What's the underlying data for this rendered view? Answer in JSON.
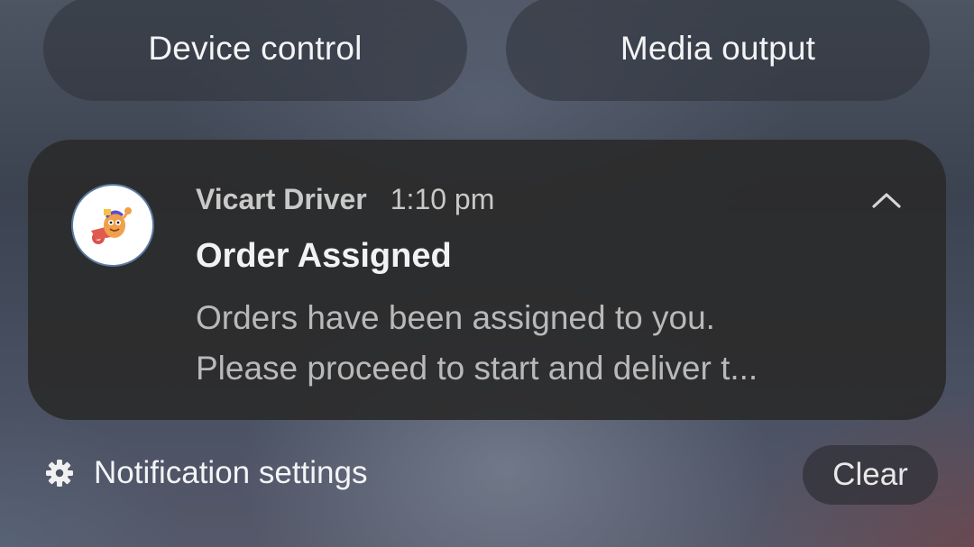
{
  "quick_buttons": {
    "device_control": "Device control",
    "media_output": "Media output"
  },
  "notification": {
    "app_name": "Vicart Driver",
    "time": "1:10 pm",
    "title": "Order Assigned",
    "body_lines": [
      "Orders have been assigned to you.",
      "Please proceed to start and deliver t..."
    ],
    "icon": "delivery-mascot-icon",
    "expand_icon": "chevron-up-icon"
  },
  "footer": {
    "settings_label": "Notification settings",
    "settings_icon": "gear-icon",
    "clear_label": "Clear"
  }
}
